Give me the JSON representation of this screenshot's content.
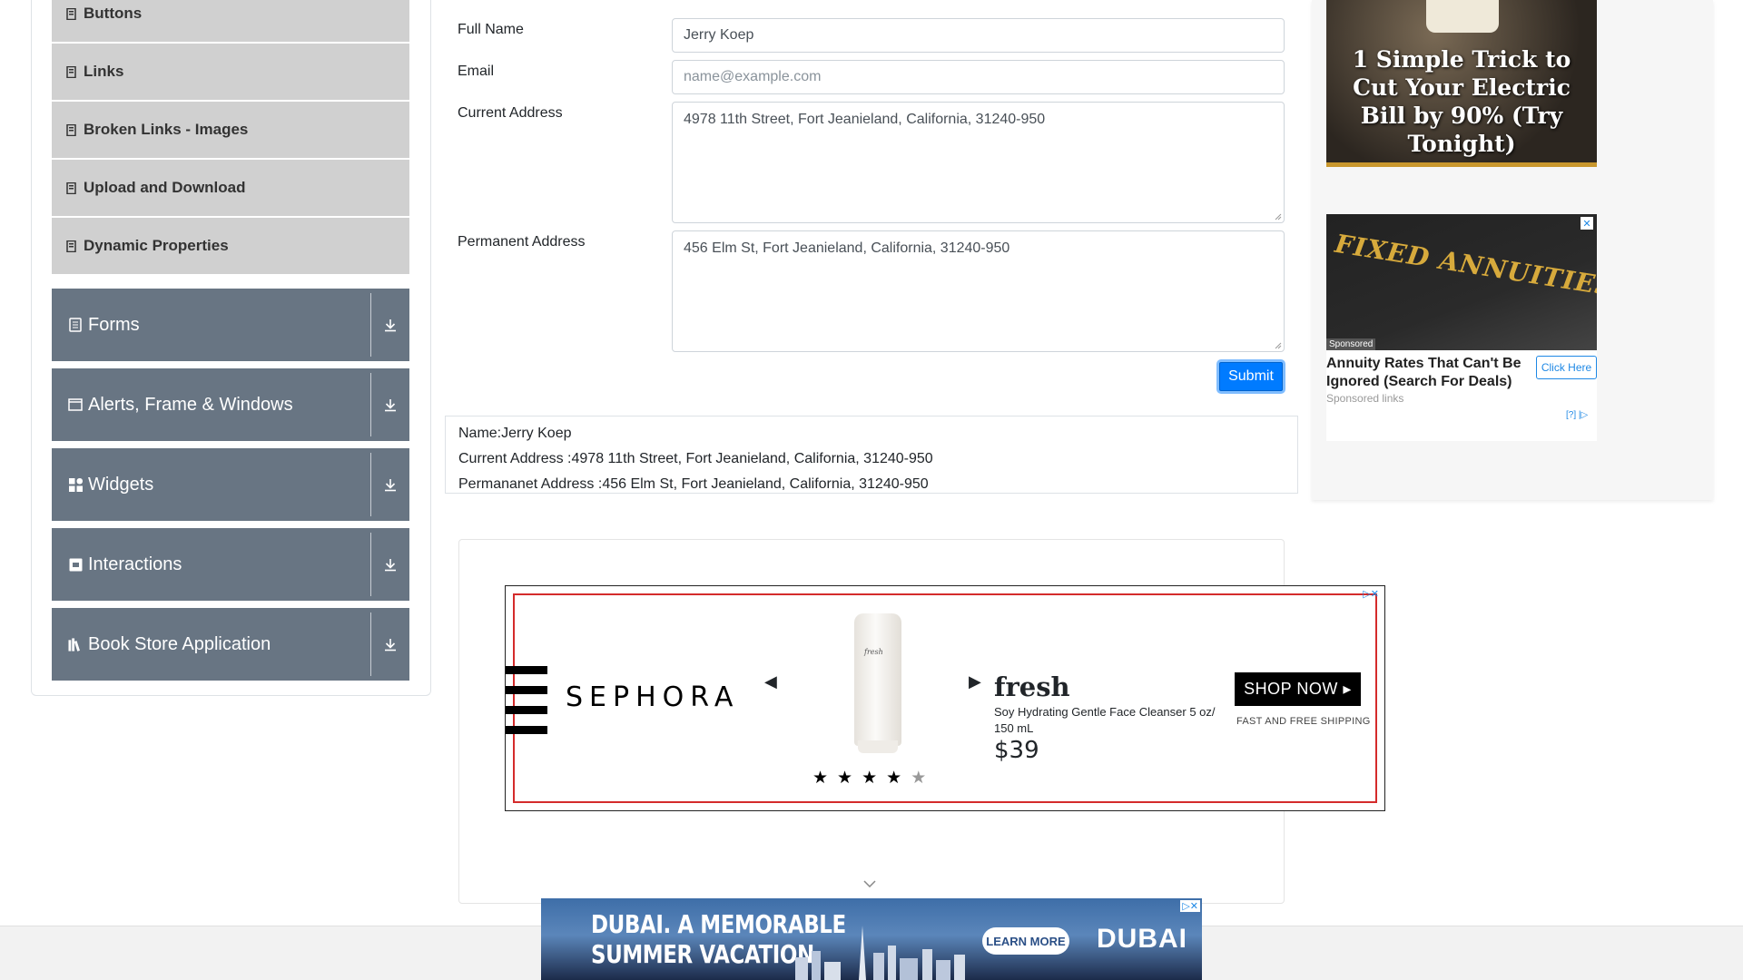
{
  "sidebar": {
    "elements_items": [
      {
        "label": "Buttons"
      },
      {
        "label": "Links"
      },
      {
        "label": "Broken Links - Images"
      },
      {
        "label": "Upload and Download"
      },
      {
        "label": "Dynamic Properties"
      }
    ],
    "groups": [
      {
        "label": "Forms",
        "icon": "form-icon"
      },
      {
        "label": "Alerts, Frame & Windows",
        "icon": "window-icon"
      },
      {
        "label": "Widgets",
        "icon": "widgets-icon"
      },
      {
        "label": "Interactions",
        "icon": "interactions-icon"
      },
      {
        "label": "Book Store Application",
        "icon": "books-icon"
      }
    ]
  },
  "form": {
    "full_name": {
      "label": "Full Name",
      "value": "Jerry Koep"
    },
    "email": {
      "label": "Email",
      "placeholder": "name@example.com"
    },
    "current_address": {
      "label": "Current Address",
      "value": "4978 11th Street, Fort Jeanieland, California, 31240-950"
    },
    "permanent_address": {
      "label": "Permanent Address",
      "value": "456 Elm St, Fort Jeanieland, California, 31240-950"
    },
    "submit_label": "Submit"
  },
  "output": {
    "name": "Name:Jerry Koep",
    "current_address": "Current Address :4978 11th Street, Fort Jeanieland, California, 31240-950",
    "permanent_address": "Permananet Address :456 Elm St, Fort Jeanieland, California, 31240-950"
  },
  "ads": {
    "sephora": {
      "logo": "SEPHORA",
      "brand": "fresh",
      "product_brand_on_tube": "fresh",
      "description": "Soy Hydrating Gentle Face Cleanser 5 oz/ 150 mL",
      "price": "$39",
      "rating": 4,
      "rating_max": 5,
      "cta": "SHOP NOW ▸",
      "shipping": "FAST AND FREE SHIPPING"
    },
    "electric": {
      "title": "1 Simple Trick to Cut Your Electric Bill by 90% (Try Tonight)"
    },
    "annuities": {
      "image_text": "FIXED ANNUITIES",
      "sponsored_tag": "Sponsored",
      "headline": "Annuity Rates That Can't Be Ignored (Search For Deals)",
      "cta": "Click Here",
      "sponsored_links": "Sponsored links",
      "info": "[?] |"
    },
    "dubai": {
      "title_line1": "DUBAI. A MEMORABLE",
      "title_line2": "SUMMER VACATION",
      "cta": "LEARN MORE",
      "logo": "DUBAI"
    }
  },
  "colors": {
    "sidebar_group_bg": "#687583",
    "sidebar_item_bg": "#d0d0d0",
    "primary": "#007bff"
  }
}
